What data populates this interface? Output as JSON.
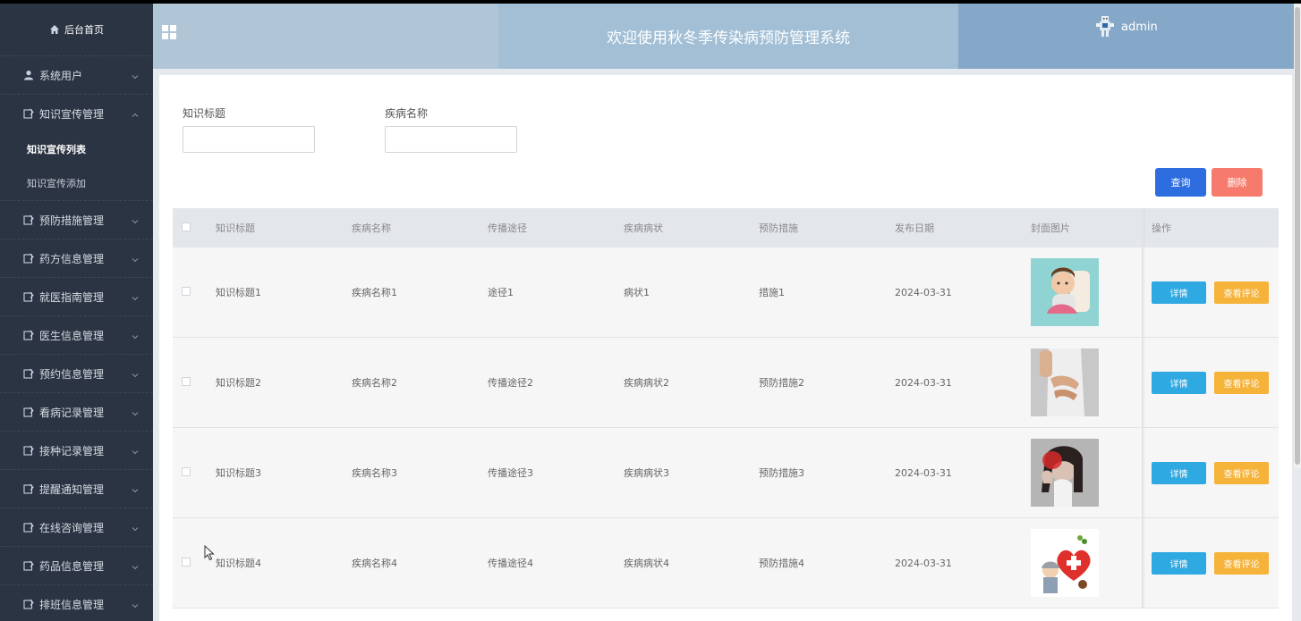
{
  "sidebar": {
    "home_label": "后台首页",
    "items": [
      {
        "label": "系统用户",
        "icon": "user-icon",
        "expanded": false
      },
      {
        "label": "知识宣传管理",
        "icon": "doc-edit-icon",
        "expanded": true
      },
      {
        "label": "预防措施管理",
        "icon": "doc-edit-icon",
        "expanded": false
      },
      {
        "label": "药方信息管理",
        "icon": "doc-edit-icon",
        "expanded": false
      },
      {
        "label": "就医指南管理",
        "icon": "doc-edit-icon",
        "expanded": false
      },
      {
        "label": "医生信息管理",
        "icon": "doc-edit-icon",
        "expanded": false
      },
      {
        "label": "预约信息管理",
        "icon": "doc-edit-icon",
        "expanded": false
      },
      {
        "label": "看病记录管理",
        "icon": "doc-edit-icon",
        "expanded": false
      },
      {
        "label": "接种记录管理",
        "icon": "doc-edit-icon",
        "expanded": false
      },
      {
        "label": "提醒通知管理",
        "icon": "doc-edit-icon",
        "expanded": false
      },
      {
        "label": "在线咨询管理",
        "icon": "doc-edit-icon",
        "expanded": false
      },
      {
        "label": "药品信息管理",
        "icon": "doc-edit-icon",
        "expanded": false
      },
      {
        "label": "排班信息管理",
        "icon": "doc-edit-icon",
        "expanded": false
      }
    ],
    "subitems": [
      {
        "label": "知识宣传列表",
        "active": true
      },
      {
        "label": "知识宣传添加",
        "active": false
      }
    ]
  },
  "header": {
    "title": "欢迎使用秋冬季传染病预防管理系统",
    "username": "admin"
  },
  "search": {
    "field1_label": "知识标题",
    "field1_value": "",
    "field2_label": "疾病名称",
    "field2_value": "",
    "search_button": "查询",
    "delete_button": "删除"
  },
  "table": {
    "headers": [
      "知识标题",
      "疾病名称",
      "传播途径",
      "疾病病状",
      "预防措施",
      "发布日期",
      "封面图片",
      "操作"
    ],
    "rows": [
      {
        "title": "知识标题1",
        "disease": "疾病名称1",
        "route": "途径1",
        "symptom": "病状1",
        "measure": "措施1",
        "date": "2024-03-31",
        "detail": "详情",
        "comment": "查看评论"
      },
      {
        "title": "知识标题2",
        "disease": "疾病名称2",
        "route": "传播途径2",
        "symptom": "疾病病状2",
        "measure": "预防措施2",
        "date": "2024-03-31",
        "detail": "详情",
        "comment": "查看评论"
      },
      {
        "title": "知识标题3",
        "disease": "疾病名称3",
        "route": "传播途径3",
        "symptom": "疾病病状3",
        "measure": "预防措施3",
        "date": "2024-03-31",
        "detail": "详情",
        "comment": "查看评论"
      },
      {
        "title": "知识标题4",
        "disease": "疾病名称4",
        "route": "传播途径4",
        "symptom": "疾病病状4",
        "measure": "预防措施4",
        "date": "2024-03-31",
        "detail": "详情",
        "comment": "查看评论"
      }
    ]
  },
  "colors": {
    "sidebar_bg": "#2b3443",
    "search_btn": "#2d6de0",
    "delete_btn": "#f67b6c",
    "detail_btn": "#2fa9e1",
    "comment_btn": "#f5b33a"
  }
}
